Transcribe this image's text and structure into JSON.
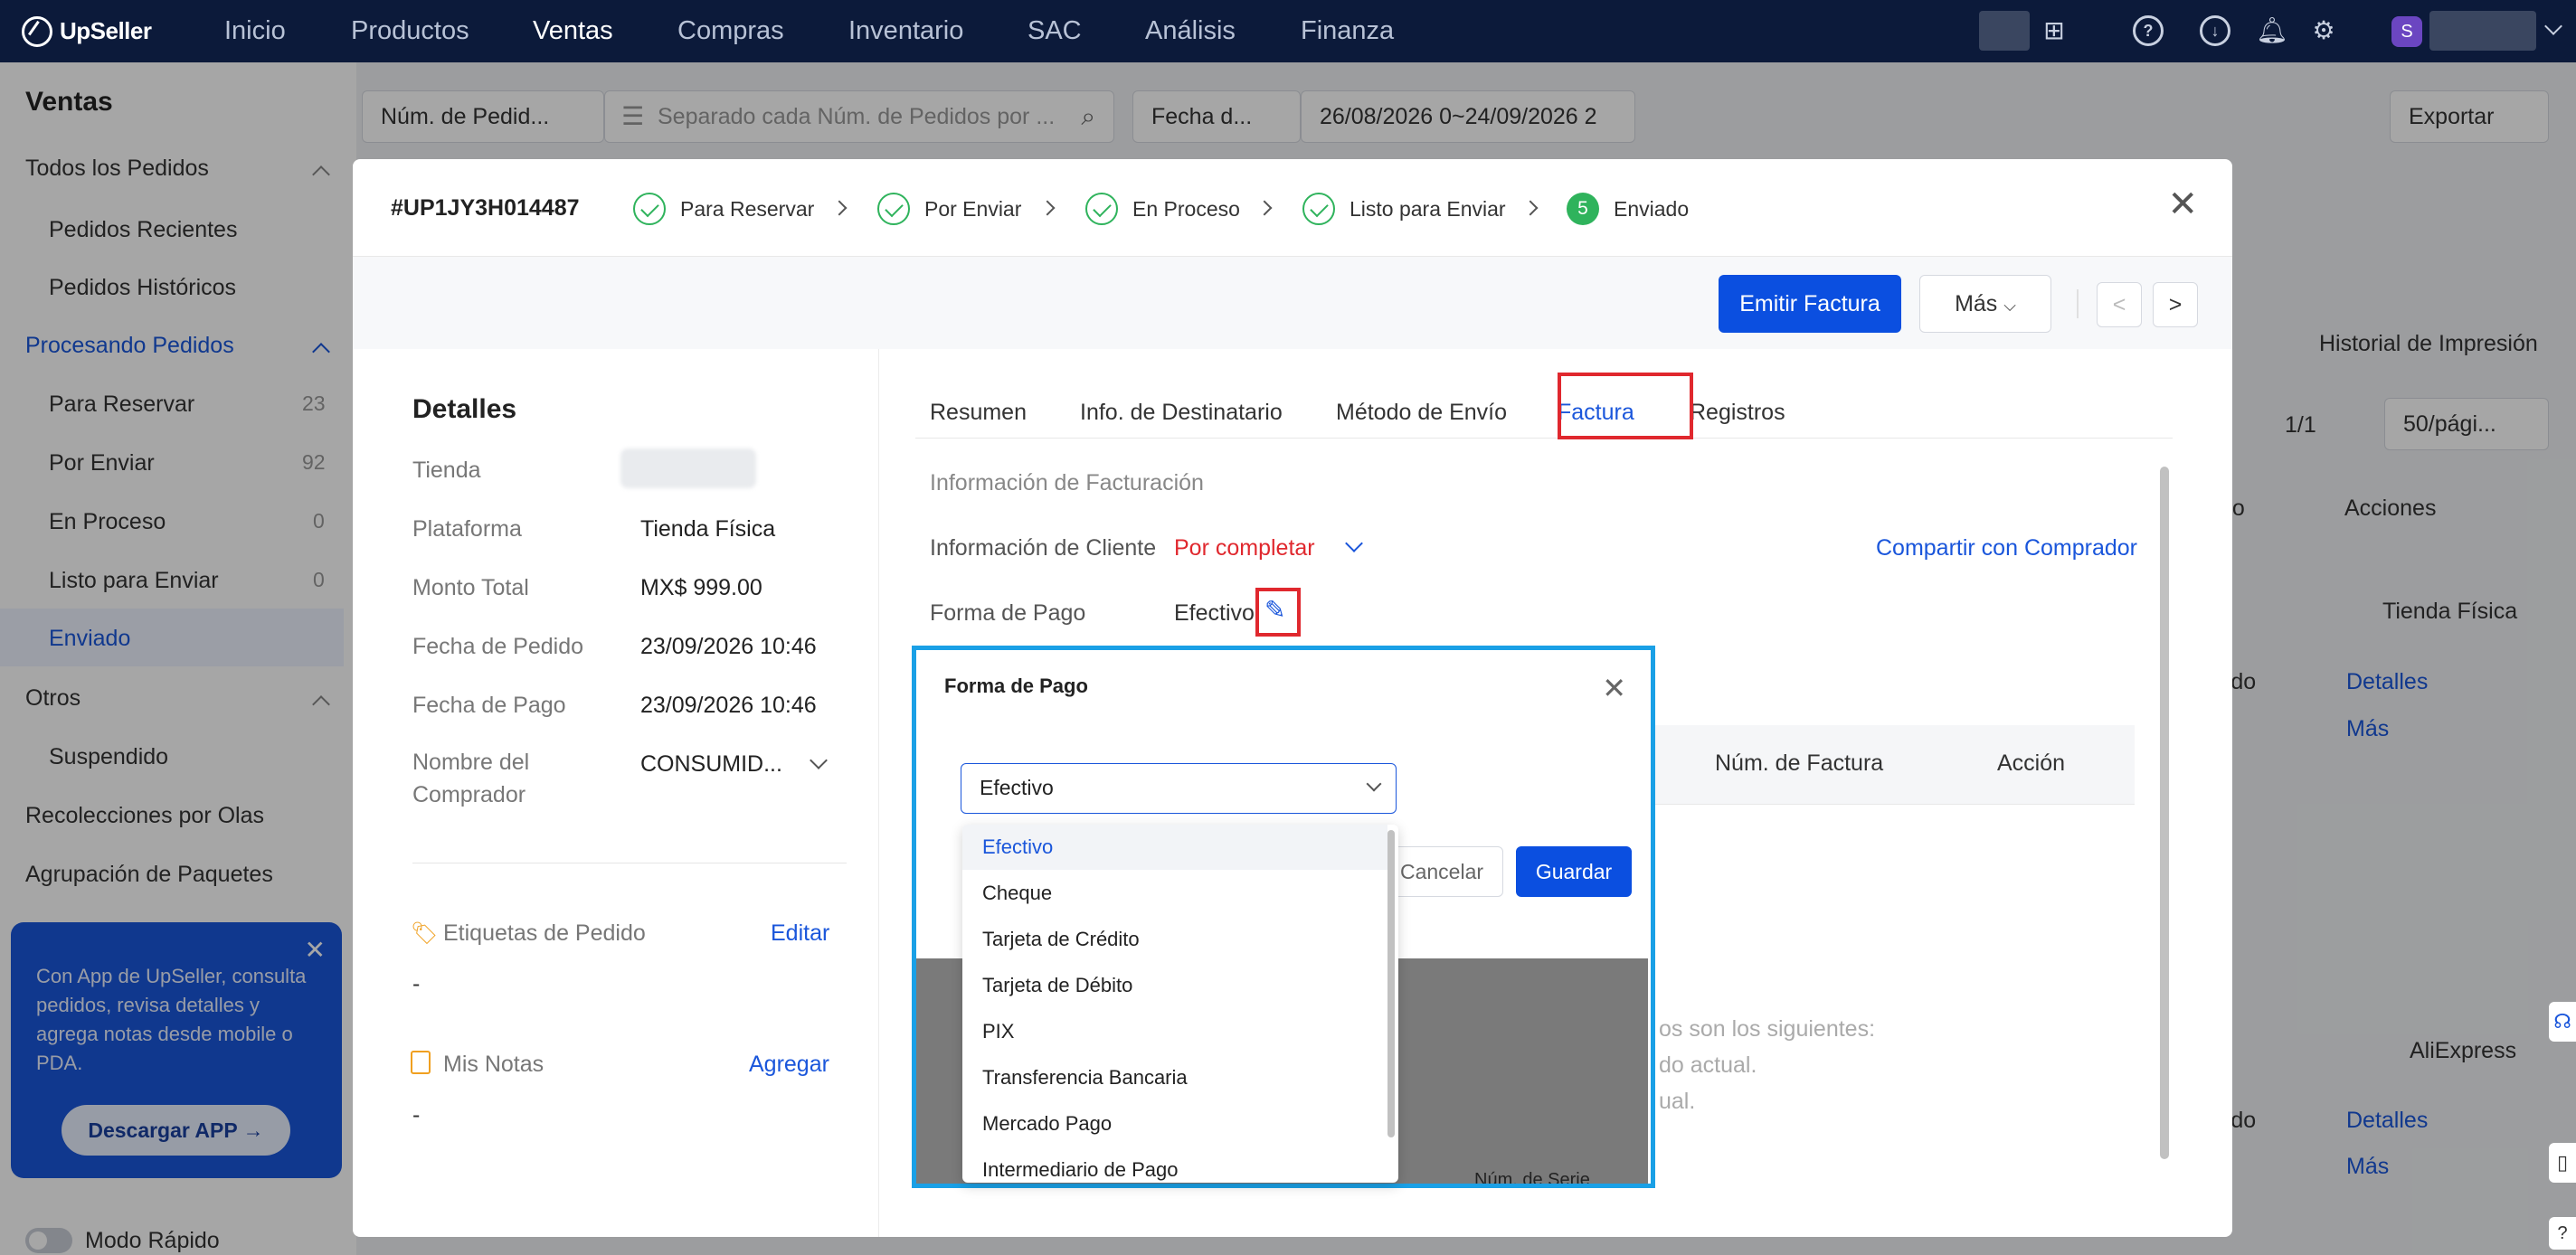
{
  "topbar": {
    "brand": "UpSeller",
    "nav": [
      "Inicio",
      "Productos",
      "Ventas",
      "Compras",
      "Inventario",
      "SAC",
      "Análisis",
      "Finanza"
    ],
    "active_nav": "Ventas",
    "avatar_letter": "S"
  },
  "sidebar": {
    "title": "Ventas",
    "all_orders": "Todos los Pedidos",
    "recent": "Pedidos Recientes",
    "history": "Pedidos Históricos",
    "processing": "Procesando Pedidos",
    "to_reserve": {
      "label": "Para Reservar",
      "count": "23"
    },
    "to_ship": {
      "label": "Por Enviar",
      "count": "92"
    },
    "in_process": {
      "label": "En Proceso",
      "count": "0"
    },
    "ready": {
      "label": "Listo para Enviar",
      "count": "0"
    },
    "shipped": "Enviado",
    "others": "Otros",
    "suspended": "Suspendido",
    "wave_pick": "Recolecciones por Olas",
    "grouping": "Agrupación de Paquetes",
    "promo_text": "Con App de UpSeller, consulta pedidos, revisa detalles y agrega notas desde mobile o PDA.",
    "promo_button": "Descargar APP →",
    "quick_mode": "Modo Rápido"
  },
  "filters": {
    "order_type": "Núm. de Pedid...",
    "search_placeholder": "Separado cada Núm. de Pedidos por ...",
    "date_type": "Fecha d...",
    "date_range": "26/08/2026 0~24/09/2026 2",
    "export": "Exportar"
  },
  "background": {
    "print_history": "Historial de Impresión",
    "pagination": "1/1",
    "per_page": "50/pági...",
    "col_do": "do",
    "col_actions": "Acciones",
    "store_1": "Tienda Física",
    "cado_1": "cado",
    "details_1": "Detalles",
    "more_1": "Más",
    "store_2": "AliExpress",
    "cado_2": "cado",
    "details_2": "Detalles",
    "more_2": "Más",
    "note_line1": "os son los siguientes:",
    "note_line2": "do actual.",
    "note_line3": "ual."
  },
  "modal": {
    "order_id": "#UP1JY3H014487",
    "steps": [
      "Para Reservar",
      "Por Enviar",
      "En Proceso",
      "Listo para Enviar",
      "Enviado"
    ],
    "step5_num": "5",
    "emit_invoice": "Emitir Factura",
    "more": "Más",
    "prev": "<",
    "next": ">",
    "details_title": "Detalles",
    "store_label": "Tienda",
    "platform_label": "Plataforma",
    "platform_value": "Tienda Física",
    "total_label": "Monto Total",
    "total_value": "MX$ 999.00",
    "order_date_label": "Fecha de Pedido",
    "order_date_value": "23/09/2026 10:46",
    "pay_date_label": "Fecha de Pago",
    "pay_date_value": "23/09/2026 10:46",
    "buyer_label": "Nombre del Comprador",
    "buyer_value": "CONSUMID...",
    "tags_label": "Etiquetas de Pedido",
    "tags_edit": "Editar",
    "tags_value": "-",
    "notes_label": "Mis Notas",
    "notes_add": "Agregar",
    "notes_value": "-",
    "tabs": [
      "Resumen",
      "Info. de Destinatario",
      "Método de Envío",
      "Factura",
      "Registros"
    ],
    "active_tab": "Factura",
    "billing_info": "Información de Facturación",
    "client_info_label": "Información de Cliente",
    "client_info_value": "Por completar",
    "share": "Compartir con Comprador",
    "payment_label": "Forma de Pago",
    "payment_value": "Efectivo",
    "col_invoice_num": "Núm. de Factura",
    "col_action": "Acción",
    "serial_col": "Núm. de Serie"
  },
  "payment_popup": {
    "title": "Forma de Pago",
    "selected": "Efectivo",
    "options": [
      "Efectivo",
      "Cheque",
      "Tarjeta de Crédito",
      "Tarjeta de Débito",
      "PIX",
      "Transferencia Bancaria",
      "Mercado Pago",
      "Intermediario de Pago"
    ],
    "cancel": "Cancelar",
    "save": "Guardar"
  },
  "colors": {
    "primary": "#0b4fe0",
    "success": "#2fb35c",
    "danger": "#e0282e",
    "highlight": "#1aa0e6"
  }
}
